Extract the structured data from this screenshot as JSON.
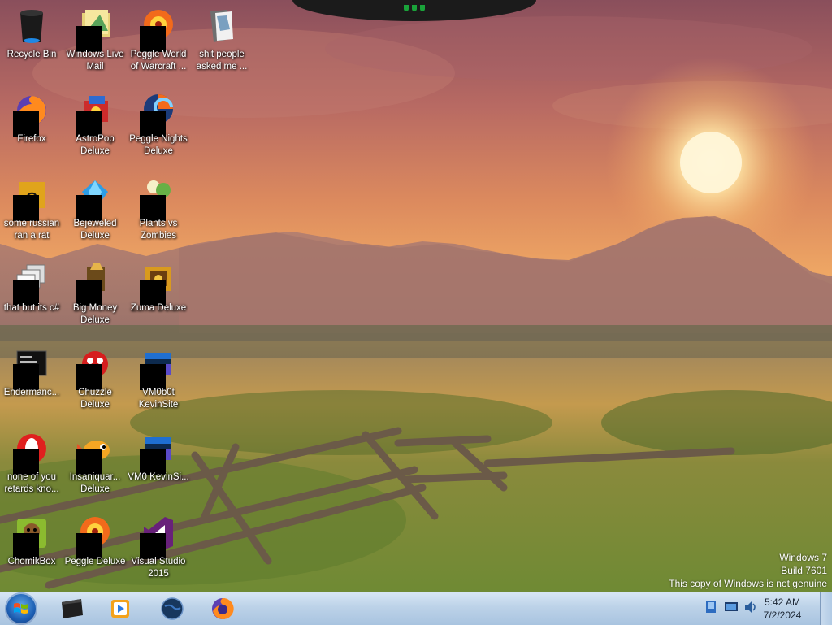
{
  "desktop": {
    "icons": [
      {
        "name": "icon-recycle-bin",
        "label": "Recycle Bin",
        "art": "recycle-bin-icon",
        "censored": false
      },
      {
        "name": "icon-windows-live-mail",
        "label": "Windows Live Mail",
        "art": "mail-icon",
        "censored": true
      },
      {
        "name": "icon-peggle-world-of-warcraft",
        "label": "Peggle World of Warcraft ...",
        "art": "peggle-icon",
        "censored": true
      },
      {
        "name": "icon-folder-shit-people",
        "label": "shit people asked me ...",
        "art": "folder-icon",
        "censored": false
      },
      {
        "name": "icon-firefox",
        "label": "Firefox",
        "art": "firefox-icon",
        "censored": true
      },
      {
        "name": "icon-astropop-deluxe",
        "label": "AstroPop Deluxe",
        "art": "astropop-icon",
        "censored": true
      },
      {
        "name": "icon-peggle-nights-deluxe",
        "label": "Peggle Nights Deluxe",
        "art": "peggle-nights-icon",
        "censored": true
      },
      {
        "name": "icon-some-russian-ran-a-rat",
        "label": "some russian ran a rat",
        "art": "document-icon",
        "censored": true
      },
      {
        "name": "icon-bejeweled-deluxe",
        "label": "Bejeweled Deluxe",
        "art": "bejeweled-icon",
        "censored": true
      },
      {
        "name": "icon-plants-vs-zombies",
        "label": "Plants vs Zombies",
        "art": "plants-icon",
        "censored": true
      },
      {
        "name": "icon-that-but-its-csharp",
        "label": "that but its c#",
        "art": "stack-icon",
        "censored": true
      },
      {
        "name": "icon-big-money-deluxe",
        "label": "Big Money Deluxe",
        "art": "money-icon",
        "censored": true
      },
      {
        "name": "icon-zuma-deluxe",
        "label": "Zuma Deluxe",
        "art": "zuma-icon",
        "censored": true
      },
      {
        "name": "icon-endermanch",
        "label": "Endermanc...",
        "art": "terminal-icon",
        "censored": true
      },
      {
        "name": "icon-chuzzle-deluxe",
        "label": "Chuzzle Deluxe",
        "art": "chuzzle-icon",
        "censored": true
      },
      {
        "name": "icon-vm0b0t-kevinsite",
        "label": "VM0b0t KevinSite",
        "art": "vm-icon",
        "censored": true
      },
      {
        "name": "icon-none-of-you-retards",
        "label": "none of you retards kno...",
        "art": "opera-icon",
        "censored": true
      },
      {
        "name": "icon-insaniquarium-deluxe",
        "label": "Insaniquar... Deluxe",
        "art": "fish-icon",
        "censored": true
      },
      {
        "name": "icon-vm0-kevinsite",
        "label": "VM0 KevinSi...",
        "art": "vm-icon",
        "censored": true
      },
      {
        "name": "icon-chomikbox",
        "label": "ChomikBox",
        "art": "chomikbox-icon",
        "censored": true
      },
      {
        "name": "icon-peggle-deluxe",
        "label": "Peggle Deluxe",
        "art": "peggle-icon",
        "censored": true
      },
      {
        "name": "icon-visual-studio-2015",
        "label": "Visual Studio 2015",
        "art": "visual-studio-icon",
        "censored": true
      }
    ]
  },
  "watermark": {
    "line1": "Windows 7",
    "line2": "Build 7601",
    "line3": "This copy of Windows is not genuine"
  },
  "taskbar": {
    "pinned": [
      {
        "name": "taskbar-terminal",
        "icon": "terminal-icon"
      },
      {
        "name": "taskbar-media-player",
        "icon": "media-player-icon"
      },
      {
        "name": "taskbar-globe",
        "icon": "globe-icon"
      },
      {
        "name": "taskbar-firefox",
        "icon": "firefox-icon"
      }
    ],
    "tray": [
      "network-icon",
      "display-icon",
      "volume-icon"
    ],
    "clock": {
      "time": "5:42 AM",
      "date": "7/2/2024"
    }
  },
  "colors": {
    "taskbar": "#bcd2e8",
    "sky_top": "#8a4f5c",
    "sun": "#fff6d8"
  }
}
